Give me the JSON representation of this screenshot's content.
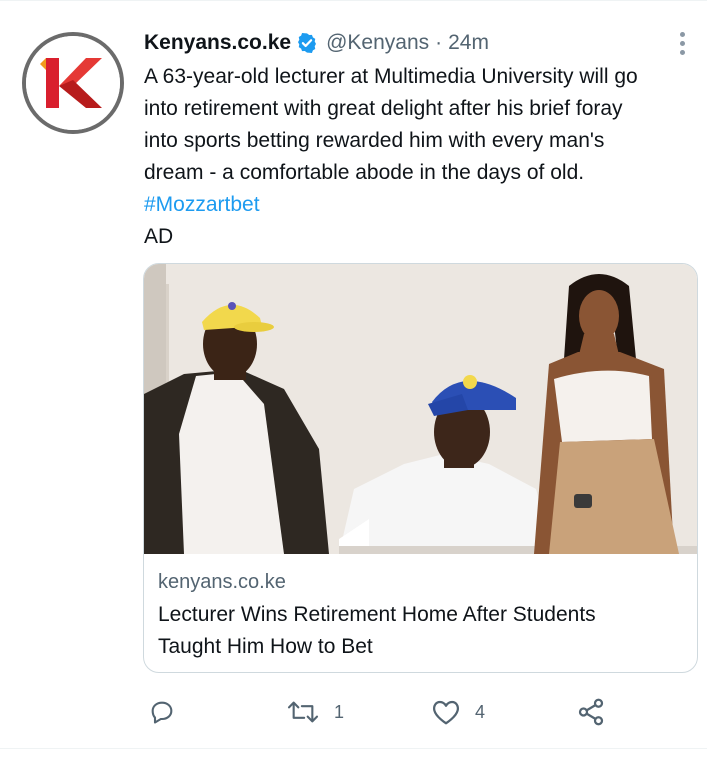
{
  "tweet": {
    "display_name": "Kenyans.co.ke",
    "handle": "@Kenyans",
    "separator": "·",
    "time": "24m",
    "text_line1": "A 63-year-old lecturer at Multimedia University will go",
    "text_line2": "into retirement with great delight after his brief foray",
    "text_line3": "into sports betting rewarded him with every man's",
    "text_line4": "dream - a comfortable abode in the days of old.",
    "hashtag": "#Mozzartbet",
    "ad_label": "AD",
    "avatar_letter": "K"
  },
  "card": {
    "domain": "kenyans.co.ke",
    "title_line1": "Lecturer Wins Retirement Home After Students",
    "title_line2": "Taught Him How to Bet"
  },
  "actions": {
    "reply_count": "",
    "retweet_count": "1",
    "like_count": "4"
  },
  "icons": [
    "verified-badge-icon",
    "more-icon",
    "reply-icon",
    "retweet-icon",
    "like-icon",
    "share-icon"
  ],
  "colors": {
    "accent": "#1d9bf0",
    "secondary_text": "#536471",
    "logo_red": "#e0202e",
    "border": "#cfd9de"
  }
}
